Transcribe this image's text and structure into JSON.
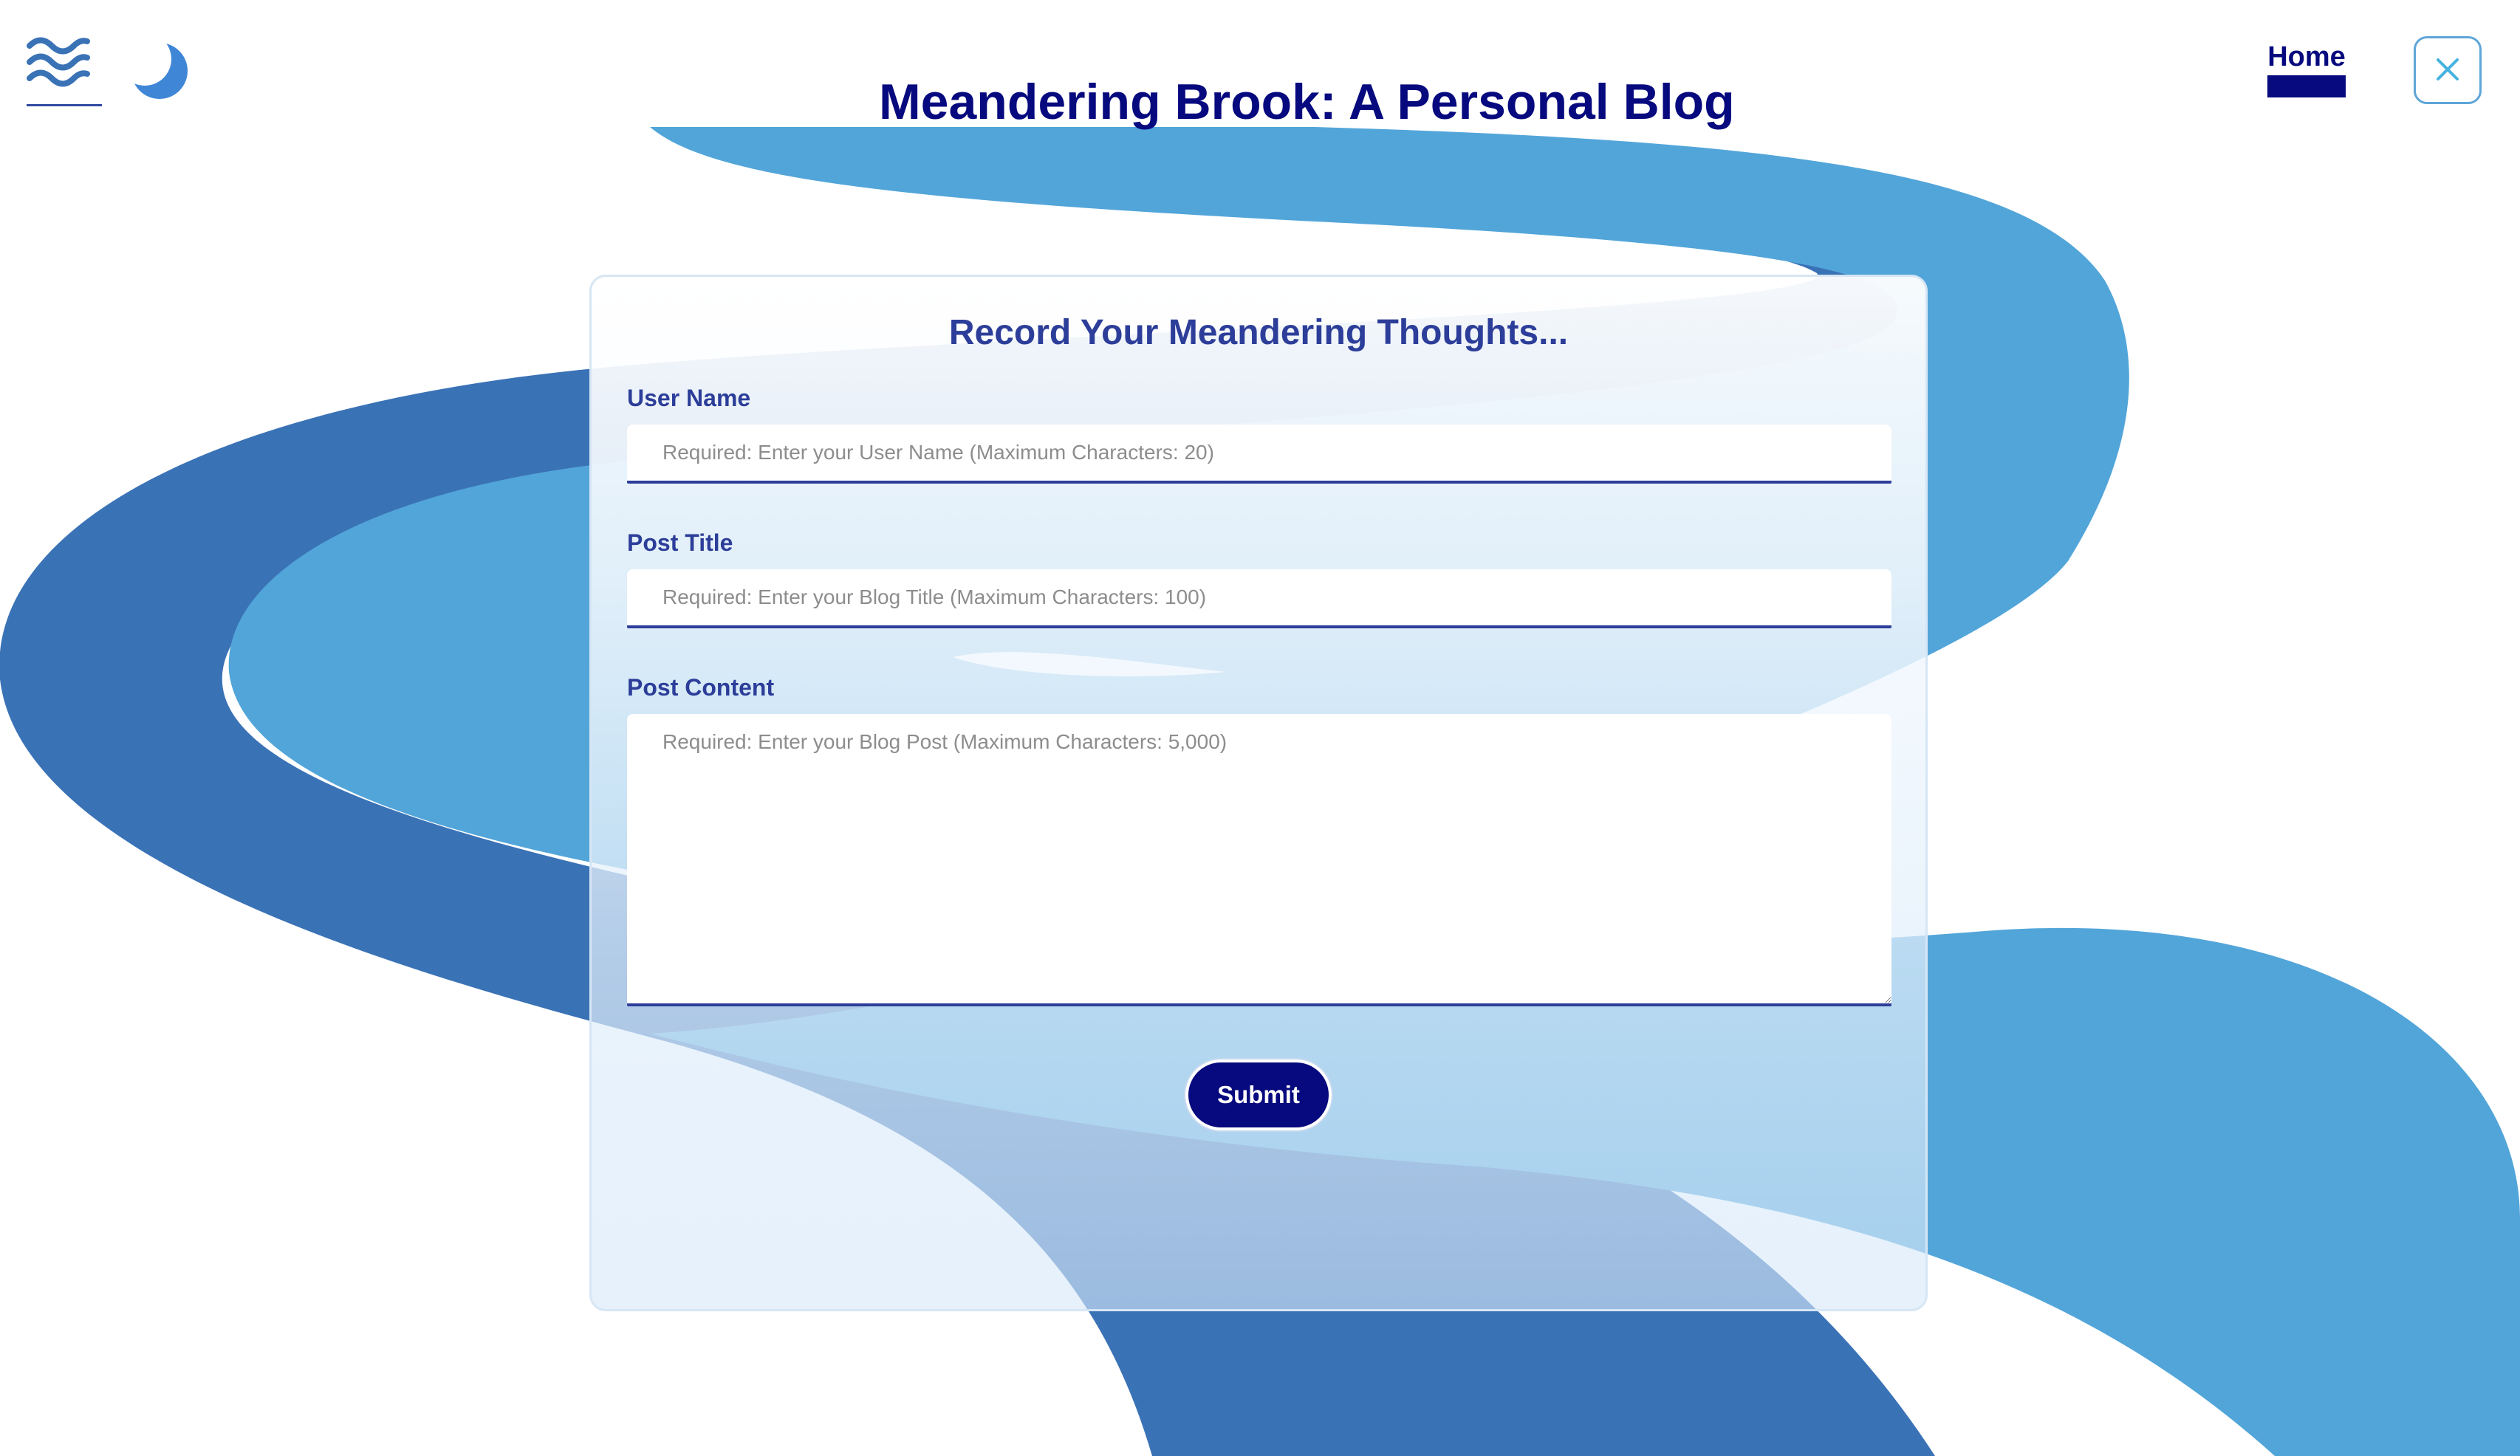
{
  "site": {
    "title": "Meandering Brook: A Personal Blog",
    "logo_icon": "waves-icon",
    "theme_icon": "moon-icon"
  },
  "nav": {
    "home_label": "Home",
    "close_icon": "close-icon"
  },
  "form": {
    "heading": "Record Your Meandering Thoughts...",
    "fields": [
      {
        "label": "User Name",
        "placeholder": "Required: Enter your User Name (Maximum Characters: 20)",
        "value": ""
      },
      {
        "label": "Post Title",
        "placeholder": "Required: Enter your Blog Title (Maximum Characters: 100)",
        "value": ""
      },
      {
        "label": "Post Content",
        "placeholder": "Required: Enter your Blog Post (Maximum Characters: 5,000)",
        "value": ""
      }
    ],
    "submit_label": "Submit"
  },
  "colors": {
    "navy": "#07097e",
    "label_blue": "#2c3e99",
    "river_light": "#52a5d9",
    "river_dark": "#3a72b6",
    "accent_sky": "#5ea6d8"
  }
}
